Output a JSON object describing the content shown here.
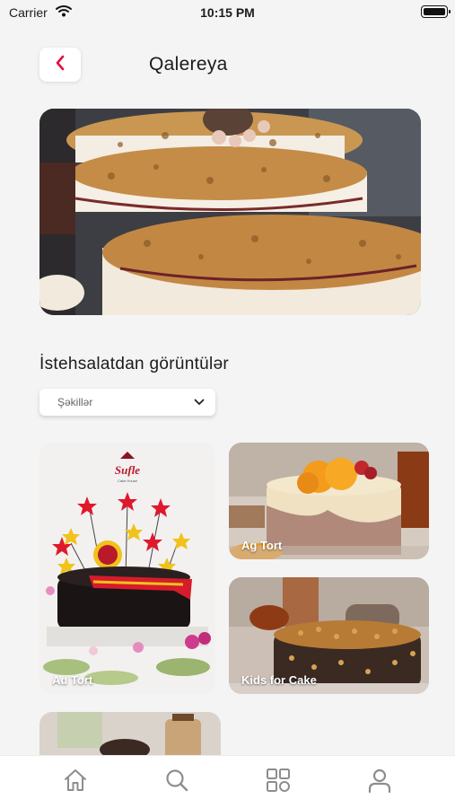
{
  "status_bar": {
    "carrier": "Carrier",
    "time": "10:15 PM"
  },
  "header": {
    "title": "Qalereya"
  },
  "section": {
    "title": "İstehsalatdan görüntülər"
  },
  "filter": {
    "selected": "Şəkillər"
  },
  "gallery": [
    {
      "label": "Ad Tort",
      "logo_text": "Sufle",
      "logo_subtext": "Cake House"
    },
    {
      "label": "Ag Tort"
    },
    {
      "label": "Kids for Cake"
    },
    {
      "label": ""
    }
  ],
  "tabbar": {
    "items": [
      {
        "icon": "home-icon"
      },
      {
        "icon": "search-icon"
      },
      {
        "icon": "grid-icon"
      },
      {
        "icon": "profile-icon"
      }
    ]
  },
  "colors": {
    "accent": "#e0113c",
    "tab_icon": "#8d8d8d",
    "background": "#f4f4f4"
  }
}
